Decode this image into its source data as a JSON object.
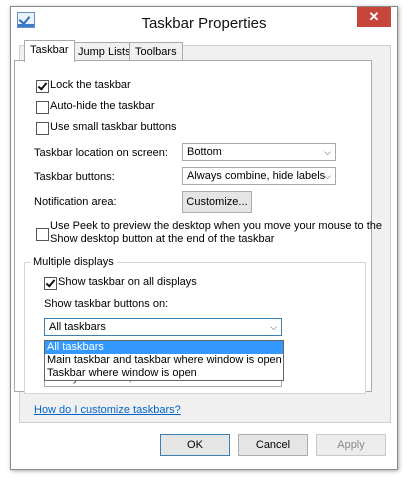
{
  "window": {
    "title": "Taskbar Properties",
    "close_glyph": "✕"
  },
  "tabs": [
    {
      "label": "Taskbar",
      "active": true
    },
    {
      "label": "Jump Lists",
      "active": false
    },
    {
      "label": "Toolbars",
      "active": false
    }
  ],
  "options": {
    "lock": {
      "label": "Lock the taskbar",
      "checked": true
    },
    "autohide": {
      "label": "Auto-hide the taskbar",
      "checked": false
    },
    "small_buttons": {
      "label": "Use small taskbar buttons",
      "checked": false
    }
  },
  "location": {
    "label": "Taskbar location on screen:",
    "value": "Bottom"
  },
  "buttons": {
    "label": "Taskbar buttons:",
    "value": "Always combine, hide labels"
  },
  "notification": {
    "label": "Notification area:",
    "button": "Customize..."
  },
  "peek": {
    "line1": "Use Peek to preview the desktop when you move your mouse to the",
    "line2": "Show desktop button at the end of the taskbar",
    "checked": false
  },
  "multiple_displays": {
    "group_label": "Multiple displays",
    "show_all": {
      "label": "Show taskbar on all displays",
      "checked": true
    },
    "show_on_label": "Show taskbar buttons on:",
    "show_on_value": "All taskbars",
    "dropdown_options": [
      "All taskbars",
      "Main taskbar and taskbar where window is open",
      "Taskbar where window is open"
    ],
    "other_buttons_value": "Always combine, hide labels"
  },
  "help_link": "How do I customize taskbars?",
  "footer": {
    "ok": "OK",
    "cancel": "Cancel",
    "apply": "Apply"
  },
  "colors": {
    "accent": "#3399ff",
    "close": "#c7463b",
    "link": "#0066cc"
  }
}
